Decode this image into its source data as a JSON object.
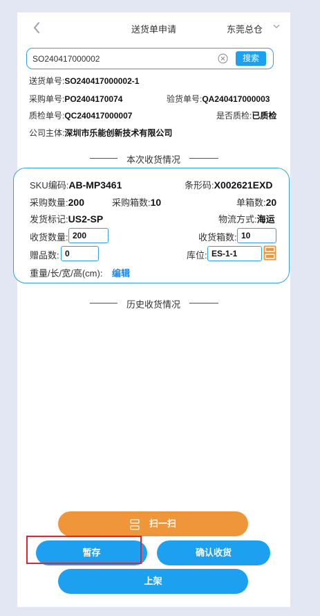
{
  "header": {
    "title": "送货单申请",
    "warehouse": "东莞总仓"
  },
  "search": {
    "value": "SO240417000002",
    "button": "搜索"
  },
  "info": {
    "delivery_no_label": "送货单号:",
    "delivery_no": "SO240417000002-1",
    "po_no_label": "采购单号:",
    "po_no": "PO2404170074",
    "inspect_no_label": "验货单号:",
    "inspect_no": "QA240417000003",
    "qc_no_label": "质检单号:",
    "qc_no": "QC240417000007",
    "qc_status_label": "是否质检:",
    "qc_status": "已质检",
    "company_label": "公司主体:",
    "company": "深圳市乐能创新技术有限公司"
  },
  "sections": {
    "current": "本次收货情况",
    "history": "历史收货情况"
  },
  "card": {
    "sku_label": "SKU编码:",
    "sku": "AB-MP3461",
    "barcode_label": "条形码:",
    "barcode": "X002621EXD",
    "purchase_qty_label": "采购数量:",
    "purchase_qty": "200",
    "purchase_boxes_label": "采购箱数:",
    "purchase_boxes": "10",
    "per_box_label": "单箱数:",
    "per_box": "20",
    "ship_mark_label": "发货标记:",
    "ship_mark": "US2-SP",
    "logistics_label": "物流方式:",
    "logistics": "海运",
    "recv_qty_label": "收货数量:",
    "recv_qty": "200",
    "recv_boxes_label": "收货箱数:",
    "recv_boxes": "10",
    "gift_label": "赠品数:",
    "gift": "0",
    "location_label": "库位:",
    "location": "ES-1-1",
    "dims_label": "重量/长/宽/高(cm):",
    "edit": "编辑"
  },
  "buttons": {
    "scan": "扫一扫",
    "save": "暂存",
    "confirm": "确认收货",
    "shelf": "上架"
  },
  "colors": {
    "primary": "#1ea0f0",
    "scan": "#f0963a",
    "highlight": "#e5232b",
    "border": "#2ea1e8"
  }
}
